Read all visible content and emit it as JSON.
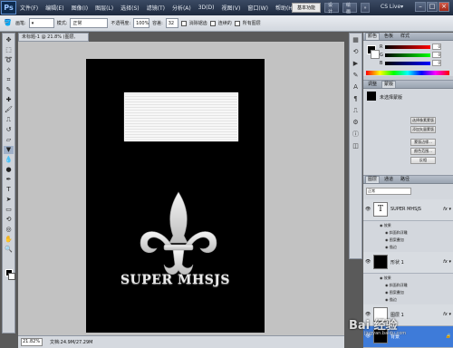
{
  "app": {
    "logo": "Ps",
    "menu": [
      "文件(F)",
      "编辑(E)",
      "图像(I)",
      "图层(L)",
      "选择(S)",
      "滤镜(T)",
      "分析(A)",
      "3D(D)",
      "视图(V)",
      "窗口(W)",
      "帮助(H)"
    ],
    "zoom_label": "21.8",
    "workspace_active": "基本功能",
    "workspace_design": "设计",
    "workspace_painting": "绘画",
    "workspace_more": "»",
    "cslive": "CS Live▾",
    "win_min": "–",
    "win_max": "□",
    "win_close": "×"
  },
  "options": {
    "brush_label": "画笔:",
    "mode_label": "模式:",
    "mode_value": "正常",
    "opacity_label": "不透明度:",
    "opacity_value": "100%",
    "flow_label": "容差:",
    "flow_value": "32",
    "anti_alias": "消除锯齿",
    "contiguous": "连续的",
    "all_layers": "所有图层"
  },
  "document": {
    "tab_title": "未标题-1 @ 21.8% (图层, RGB/8)",
    "logo_text": "SUPER MHSJS",
    "zoom": "21.82%",
    "doc_size": "文档:24.9M/27.29M"
  },
  "color_panel": {
    "tabs": [
      "颜色",
      "色板",
      "样式"
    ],
    "r_label": "R",
    "r_value": "0",
    "g_label": "G",
    "g_value": "0",
    "b_label": "B",
    "b_value": "0"
  },
  "adjustments_panel": {
    "tabs": [
      "调整",
      "蒙版"
    ],
    "title": "未选择蒙版",
    "btn_pixel": "选择像素蒙版",
    "btn_vector": "添加矢量蒙版",
    "btn_refine": "蒙版边缘...",
    "btn_colorrange": "颜色范围...",
    "btn_invert": "反相"
  },
  "layers_panel": {
    "tabs": [
      "图层",
      "通道",
      "路径"
    ],
    "blend_mode": "正常",
    "layers": [
      {
        "name": "SUPER MHSJS",
        "thumb": "T",
        "fx": "fx ▾"
      },
      {
        "name": "形状 1",
        "thumb": "",
        "fx": "fx ▾"
      },
      {
        "name": "图层 1",
        "thumb": "",
        "fx": "fx ▾"
      },
      {
        "name": "背景",
        "thumb": "",
        "fx": ""
      }
    ],
    "effects_label": "效果",
    "effect_bevel": "斜面和浮雕",
    "effect_overlay": "图案叠加",
    "effect_stroke": "描边",
    "bottom_icons": [
      "⛓",
      "fx",
      "◑",
      "▢",
      "▭",
      "🗑"
    ]
  },
  "watermark": {
    "text": "Bai 经验",
    "url": "jingyan.baidu.com"
  }
}
